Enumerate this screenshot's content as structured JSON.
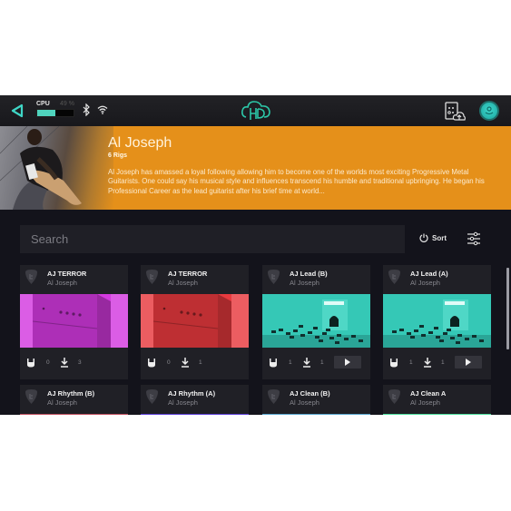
{
  "topbar": {
    "back_icon": "back-triangle-icon",
    "cpu_label": "CPU",
    "cpu_percent_text": "49 %",
    "cpu_usage": 0.49,
    "bluetooth_icon": "bluetooth-icon",
    "wifi_icon": "wifi-icon",
    "logo_icon": "hd-cloud-logo",
    "cloud_upload_icon": "cloud-upload-icon",
    "profile_icon": "profile-icon",
    "accent_color": "#3fd6c6"
  },
  "artist": {
    "name": "Al Joseph",
    "rig_count": "6 Rigs",
    "bio": "Al Joseph has amassed a loyal following allowing him to become one of the worlds most exciting Progressive Metal Guitarists. One could say his musical style and influences transcend his humble and traditional upbringing. He began his Professional Career as the lead guitarist after his brief time at world...",
    "banner_color": "#e5901a"
  },
  "search": {
    "placeholder": "Search",
    "value": ""
  },
  "toolbar": {
    "sort_label": "Sort",
    "sort_icon": "sort-icon",
    "filter_icon": "sliders-icon"
  },
  "rigs": [
    {
      "title": "AJ TERROR",
      "artist": "Al Joseph",
      "likes": "0",
      "downloads": "3",
      "image": "amp-magenta",
      "color": "#d43ae0",
      "has_play": false
    },
    {
      "title": "AJ TERROR",
      "artist": "Al Joseph",
      "likes": "0",
      "downloads": "1",
      "image": "amp-red",
      "color": "#e83a3f",
      "has_play": false
    },
    {
      "title": "AJ Lead (B)",
      "artist": "Al Joseph",
      "likes": "1",
      "downloads": "1",
      "image": "pedalboard-teal",
      "color": "#35c8b6",
      "has_play": true
    },
    {
      "title": "AJ Lead (A)",
      "artist": "Al Joseph",
      "likes": "1",
      "downloads": "1",
      "image": "pedalboard-teal",
      "color": "#35c8b6",
      "has_play": true
    },
    {
      "title": "AJ Rhythm (B)",
      "artist": "Al Joseph",
      "image": "partial",
      "color": "#c0505f"
    },
    {
      "title": "AJ Rhythm (A)",
      "artist": "Al Joseph",
      "image": "partial",
      "color": "#5b3fd8"
    },
    {
      "title": "AJ Clean (B)",
      "artist": "Al Joseph",
      "image": "partial",
      "color": "#5aa8d0"
    },
    {
      "title": "AJ Clean A",
      "artist": "Al Joseph",
      "image": "partial",
      "color": "#4fe0a0"
    }
  ]
}
